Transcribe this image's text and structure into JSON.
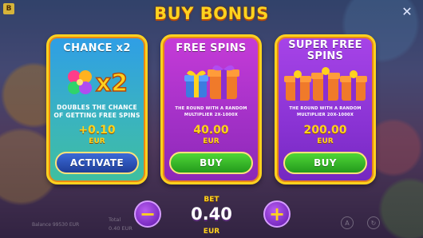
{
  "title": "BUY BONUS",
  "corner_logo": "B",
  "close_label": "✕",
  "cards": [
    {
      "title": "CHANCE x2",
      "art_text": "x2",
      "description": "DOUBLES THE CHANCE OF GETTING FREE SPINS",
      "price": "+0.10",
      "currency": "EUR",
      "button": "ACTIVATE"
    },
    {
      "title": "FREE SPINS",
      "description": "THE ROUND WITH A RANDOM MULTIPLIER 2X-1000X",
      "price": "40.00",
      "currency": "EUR",
      "button": "BUY"
    },
    {
      "title": "SUPER FREE SPINS",
      "description": "THE ROUND WITH A RANDOM MULTIPLIER 20X-1000X",
      "price": "200.00",
      "currency": "EUR",
      "button": "BUY"
    }
  ],
  "bet": {
    "label": "BET",
    "value": "0.40",
    "currency": "EUR",
    "minus": "−",
    "plus": "+"
  },
  "background": {
    "balance_text": "Balance 99530 EUR",
    "total_label": "Total",
    "total_value": "0.40 EUR",
    "auto_label": "A"
  },
  "colors": {
    "title_yellow": "#ffd21e",
    "card1_bg": "#2f9ee6",
    "card2_bg": "#c63bd8",
    "card3_bg": "#a744e8",
    "buy_green": "#4fd637",
    "activate_blue": "#3b6ad8"
  }
}
